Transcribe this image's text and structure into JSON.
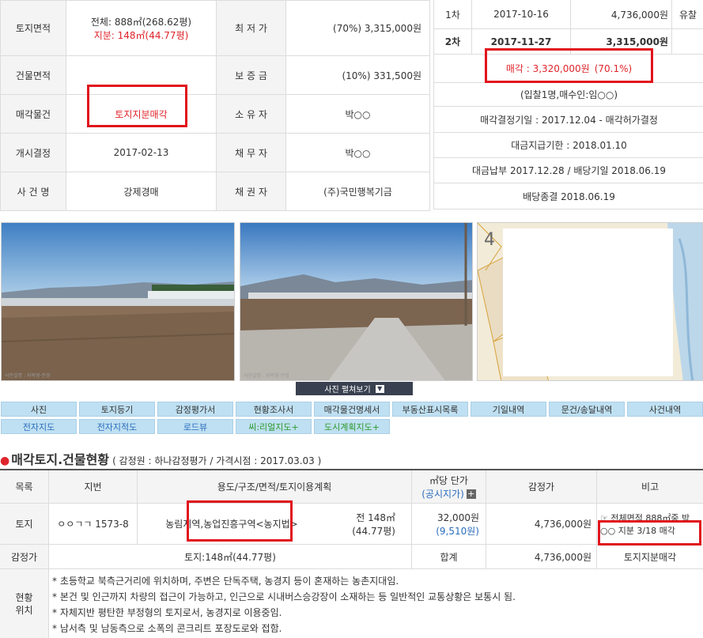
{
  "info": {
    "land_area_label": "토지면적",
    "land_area_total": "전체: 888㎡(268.62평)",
    "land_area_share": "지분: 148㎡(44.77평)",
    "min_price_label": "최 저 가",
    "min_price_value": "(70%) 3,315,000원",
    "building_area_label": "건물면적",
    "building_area_value": "",
    "deposit_label": "보 증 금",
    "deposit_value": "(10%) 331,500원",
    "sale_item_label": "매각물건",
    "sale_item_value": "토지지분매각",
    "owner_label": "소 유 자",
    "owner_value": "박○○",
    "start_label": "개시결정",
    "start_value": "2017-02-13",
    "debtor_label": "채 무 자",
    "debtor_value": "박○○",
    "case_label": "사 건 명",
    "case_value": "강제경매",
    "creditor_label": "채 권 자",
    "creditor_value": "(주)국민행복기금"
  },
  "bids": {
    "round1_label": "1차",
    "round1_date": "2017-10-16",
    "round1_price": "4,736,000원",
    "round1_status": "유찰",
    "round2_label": "2차",
    "round2_date": "2017-11-27",
    "round2_price": "3,315,000원",
    "sold_text": "매각 : 3,320,000원",
    "sold_pct": "(70.1%)",
    "bidders": "(입찰1명,매수인:임○○)",
    "decision": "매각결정기일 : 2017.12.04 - 매각허가결정",
    "payment_deadline": "대금지급기한 : 2018.01.10",
    "payment_done": "대금납부 2017.12.28 / 배당기일 2018.06.19",
    "dividend_end": "배당종결 2018.06.19"
  },
  "photos": {
    "caption1": "사진설명 : 지목형·전경",
    "caption2": "사진설명 : 지목형·전경",
    "map_mark": "4",
    "toggle_label": "사진 펼쳐보기"
  },
  "tabs_row1": [
    "사진",
    "토지등기",
    "감정평가서",
    "현황조사서",
    "매각물건명세서",
    "부동산표시목록",
    "기일내역",
    "문건/송달내역",
    "사건내역"
  ],
  "tabs_row2": [
    "전자지도",
    "전자지적도",
    "로드뷰",
    "씨:리얼지도+",
    "도시계획지도+"
  ],
  "section": {
    "title": "매각토지.건물현황",
    "subtitle": "( 감정원 : 하나감정평가 / 가격시점 : 2017.03.03 )"
  },
  "table": {
    "h_category": "목록",
    "h_lot": "지번",
    "h_use": "용도/구조/면적/토지이용계획",
    "h_unit_price": "㎡당 단가",
    "h_public": "(공시지가)",
    "h_appraisal": "감정가",
    "h_note": "비고",
    "r_category": "토지",
    "r_lot": "ㅇㅇㄱㄱ 1573-8",
    "r_use": "농림지역,농업진흥구역<농지법>",
    "r_area": "전 148㎡",
    "r_area2": "(44.77평)",
    "r_unit_price": "32,000원",
    "r_public_price": "(9,510원)",
    "r_appraisal": "4,736,000원",
    "r_note1": "☞ 전체면적 888㎡중 박",
    "r_note2": "○○ 지분 3/18 매각",
    "s_label": "감정가",
    "s_value": "토지:148㎡(44.77평)",
    "s_total_label": "합계",
    "s_total_value": "4,736,000원",
    "s_note": "토지지분매각",
    "loc_label1": "현황",
    "loc_label2": "위치",
    "notes": [
      "초등학교 북측근거리에 위치하며, 주변은 단독주택, 농경지 등이 혼재하는 농촌지대임.",
      "본건 및 인근까지 차량의 접근이 가능하고, 인근으로 시내버스승강장이 소재하는 등 일반적인 교통상황은 보통시 됨.",
      "자체지반 평탄한 부정형의 토지로서, 농경지로 이용중임.",
      "남서측 및 남동측으로 소폭의 콘크리트 포장도로와 접함."
    ]
  }
}
